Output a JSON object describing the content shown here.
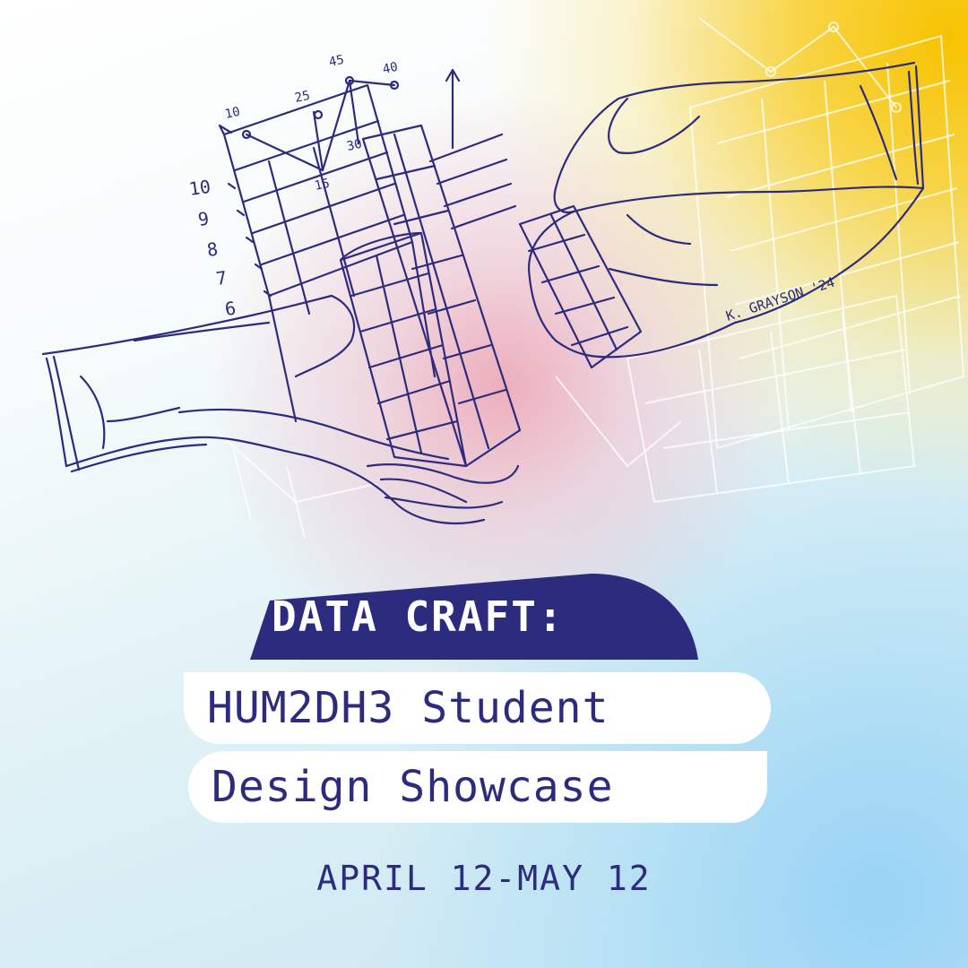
{
  "poster": {
    "title_tag": "DATA CRAFT:",
    "line1": "HUM2DH3 Student",
    "line2": "Design Showcase",
    "dates": "APRIL 12-MAY 12",
    "signature": "K. GRAYSON '24",
    "sketch_axis_numbers": [
      "10",
      "9",
      "8",
      "7",
      "6"
    ],
    "sketch_top_numbers": [
      "10",
      "25",
      "45",
      "40",
      "15",
      "30"
    ]
  },
  "colors": {
    "ink": "#2d2b7d",
    "tag_fill": "#2d2b7d",
    "pill_fill": "#ffffff",
    "accent_yellow": "#f7c200",
    "accent_blue": "#b6def4",
    "accent_pink": "#eeaab9"
  }
}
